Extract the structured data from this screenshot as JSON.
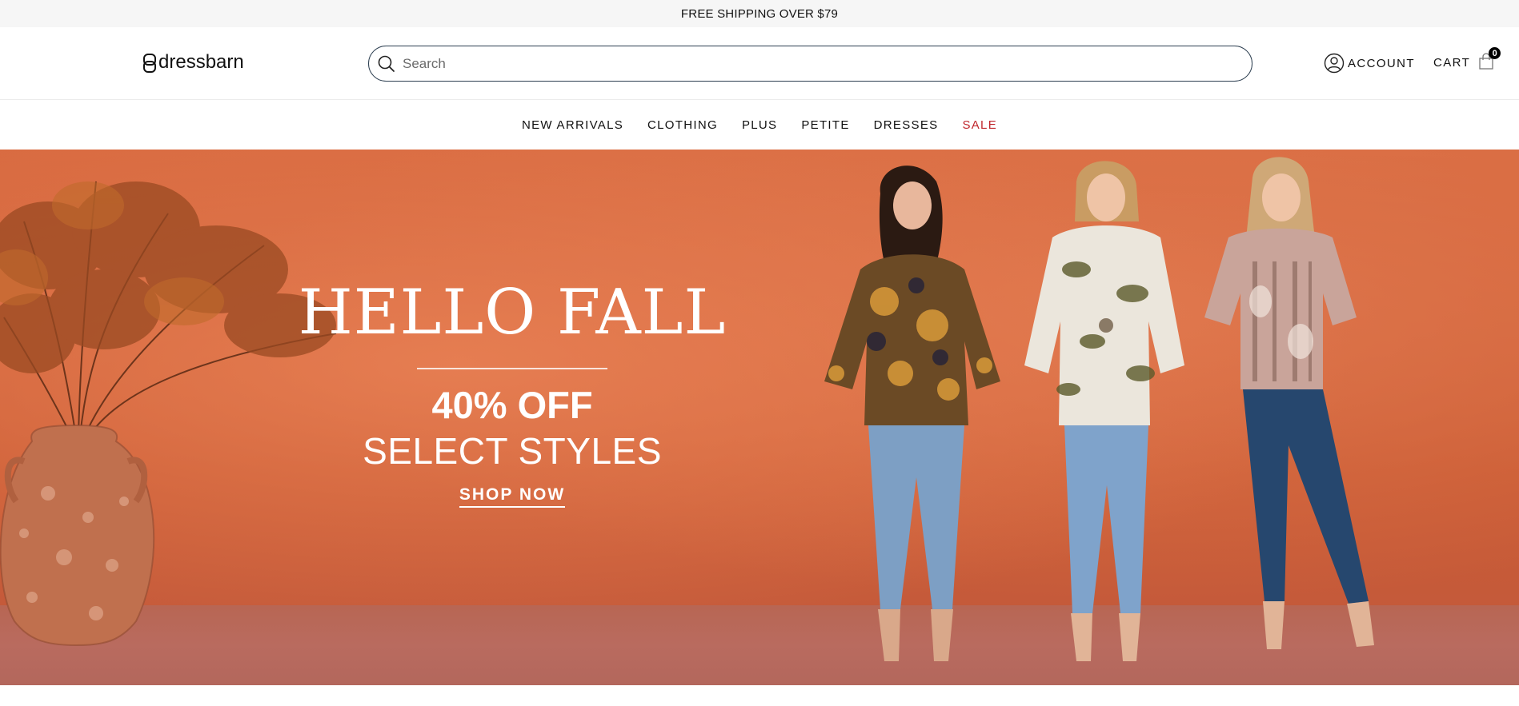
{
  "promo": {
    "text": "FREE SHIPPING OVER $79"
  },
  "header": {
    "logo_text": "dressbarn",
    "search": {
      "placeholder": "Search",
      "value": ""
    },
    "account_label": "ACCOUNT",
    "cart_label": "CART",
    "cart_count": "0"
  },
  "nav": {
    "items": [
      {
        "label": "NEW ARRIVALS"
      },
      {
        "label": "CLOTHING"
      },
      {
        "label": "PLUS"
      },
      {
        "label": "PETITE"
      },
      {
        "label": "DRESSES"
      },
      {
        "label": "SALE"
      }
    ],
    "sale_color": "#c0272d"
  },
  "hero": {
    "title": "HELLO FALL",
    "offer": "40% OFF",
    "subtitle": "SELECT STYLES",
    "cta": "SHOP NOW",
    "background_color": "#d06238"
  }
}
